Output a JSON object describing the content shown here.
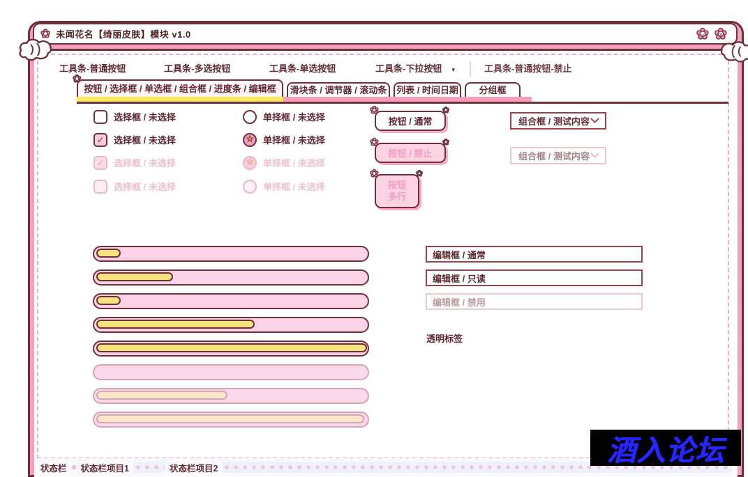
{
  "colors": {
    "frame_pink": "#f79fbb",
    "border_maroon": "#6e3139",
    "text_maroon": "#5d2a31",
    "tab_active_yellow": "#ffe95e",
    "progress_fill_yellow": "#f6e37d",
    "shadow_pink": "#f8a9c6",
    "disabled_pink_text": "#f19fbc",
    "watermark_blue": "#2525ff",
    "watermark_bg": "#000000"
  },
  "icons": {
    "flower": "✿",
    "flower_white": "❀",
    "star": "★",
    "check": "✓",
    "dropdown": "▾",
    "minimize_mark": "–",
    "close_mark": "✕"
  },
  "window": {
    "title": "未闻花名【绮丽皮肤】模块 v1.0"
  },
  "toolbar": {
    "items": [
      {
        "label": "工具条-普通按钮",
        "disabled": false
      },
      {
        "label": "工具条-多选按钮",
        "disabled": false
      },
      {
        "label": "工具条-单选按钮",
        "disabled": false
      },
      {
        "label": "工具条-下拉按钮",
        "disabled": false,
        "has_dropdown": true
      },
      {
        "label": "工具条-普通按钮-禁止",
        "disabled": true
      }
    ]
  },
  "tabs": {
    "active_index": 0,
    "items": [
      {
        "label": "按钮 / 选择框 / 单选框 / 组合框 / 进度条 / 编辑框"
      },
      {
        "label": "滑块条 / 调节器 / 滚动条"
      },
      {
        "label": "列表 / 时间日期"
      },
      {
        "label": "分组框"
      }
    ]
  },
  "checkboxes": [
    {
      "label": "选择框 / 未选择",
      "checked": false,
      "disabled": false
    },
    {
      "label": "选择框 / 未选择",
      "checked": true,
      "disabled": false
    },
    {
      "label": "选择框 / 未选择",
      "checked": true,
      "disabled": true
    },
    {
      "label": "选择框 / 未选择",
      "checked": false,
      "disabled": true
    }
  ],
  "radios": [
    {
      "label": "单择框 / 未选择",
      "checked": false,
      "disabled": false
    },
    {
      "label": "单择框 / 未选择",
      "checked": true,
      "disabled": false
    },
    {
      "label": "单择框 / 未选择",
      "checked": true,
      "disabled": true
    },
    {
      "label": "单择框 / 未选择",
      "checked": false,
      "disabled": true
    }
  ],
  "buttons": {
    "normal": "按钮 / 通常",
    "disabled": "按钮 / 禁止",
    "multiline": {
      "line1": "按钮",
      "line2": "多行"
    }
  },
  "combos": [
    {
      "value": "组合框 / 测试内容",
      "disabled": false
    },
    {
      "value": "组合框 / 测试内容",
      "disabled": true
    }
  ],
  "progress": [
    {
      "percent": 8,
      "disabled": false
    },
    {
      "percent": 27,
      "disabled": false
    },
    {
      "percent": 8,
      "disabled": false
    },
    {
      "percent": 57,
      "disabled": false
    },
    {
      "percent": 98,
      "disabled": false
    },
    {
      "percent": 0,
      "disabled": true
    },
    {
      "percent": 47,
      "disabled": true
    },
    {
      "percent": 97,
      "disabled": true
    }
  ],
  "edits": [
    {
      "value": "编辑框 / 通常",
      "state": "normal"
    },
    {
      "value": "编辑框 / 只读",
      "state": "readonly"
    },
    {
      "value": "编辑框 / 禁用",
      "state": "disabled"
    }
  ],
  "labels": {
    "transparent": "透明标签"
  },
  "statusbar": {
    "items": [
      "状态栏",
      "状态栏项目1",
      "状态栏项目2"
    ]
  },
  "watermark": {
    "text": "酒入论坛"
  }
}
